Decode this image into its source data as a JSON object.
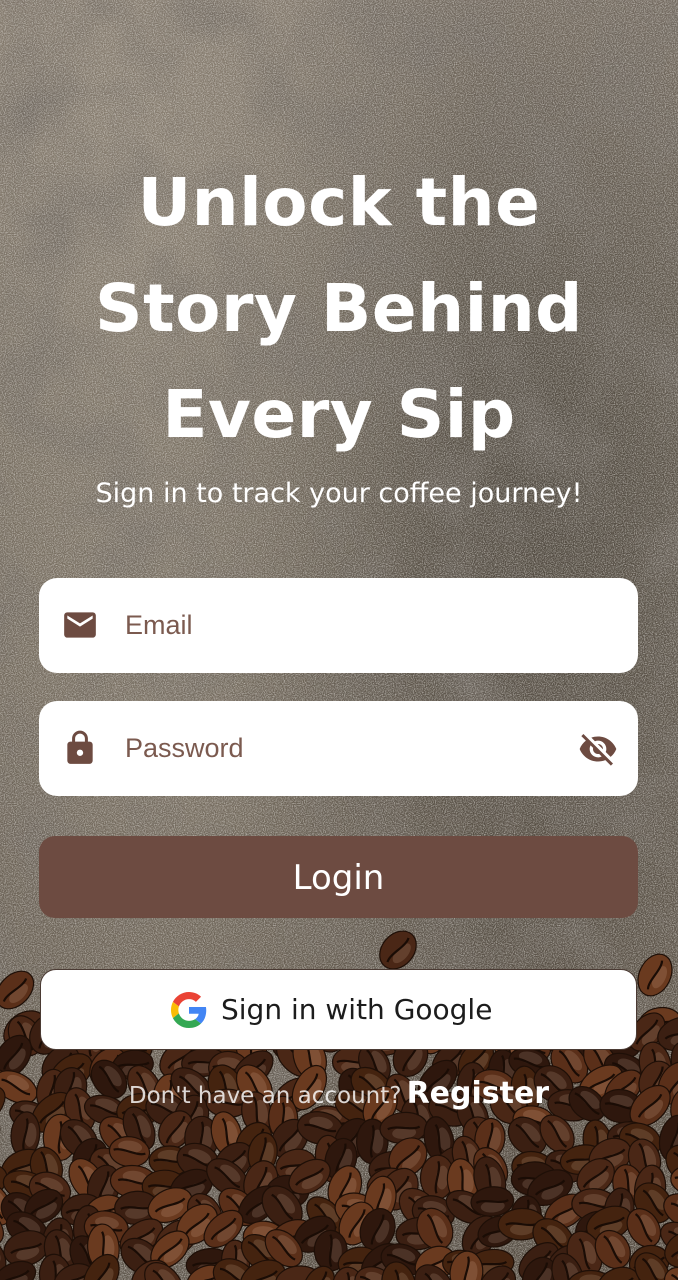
{
  "colors": {
    "accent": "#6d4b41",
    "field_background": "#ffffff",
    "icon": "#6d4b41",
    "text_on_dark": "#ffffff"
  },
  "hero": {
    "title_lines": [
      "Unlock the",
      "Story Behind",
      "Every Sip"
    ],
    "subtitle": "Sign in to track your coffee journey!"
  },
  "form": {
    "email": {
      "placeholder": "Email",
      "value": "",
      "icon": "mail-icon"
    },
    "password": {
      "placeholder": "Password",
      "value": "",
      "icon": "lock-icon",
      "toggle_icon": "visibility-off-icon"
    }
  },
  "actions": {
    "login_label": "Login",
    "google_label": "Sign in with Google",
    "google_icon": "google-g-icon"
  },
  "footer": {
    "prompt": "Don't have an account?",
    "register_label": "Register"
  }
}
